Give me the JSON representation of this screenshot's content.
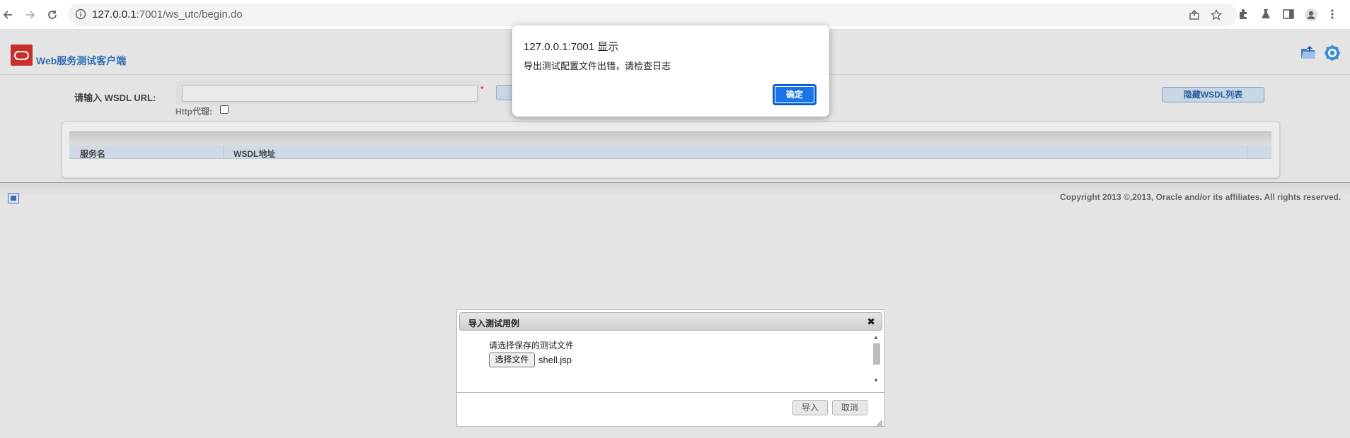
{
  "browser": {
    "url_host": "127.0.0.1",
    "url_rest": ":7001/ws_utc/begin.do"
  },
  "app": {
    "title": "Web服务测试客户端"
  },
  "form": {
    "wsdl_label": "请输入 WSDL URL:",
    "required_mark": "*",
    "proxy_label": "Http代理:",
    "hide_button": "隐藏WSDL列表"
  },
  "table": {
    "columns": [
      "服务名",
      "WSDL地址"
    ]
  },
  "footer": {
    "copyright": "Copyright 2013 ©,2013, Oracle and/or its affiliates. All rights reserved."
  },
  "import_dialog": {
    "title": "导入测试用例",
    "close_glyph": "✖",
    "prompt": "请选择保存的测试文件",
    "choose_file_button": "选择文件",
    "file_name": "shell.jsp",
    "import_button": "导入",
    "cancel_button": "取消"
  },
  "alert": {
    "title": "127.0.0.1:7001 显示",
    "message": "导出测试配置文件出错，请检查日志",
    "ok_button": "确定"
  },
  "colors": {
    "accent": "#1a73e8",
    "title_blue": "#2f6eb5",
    "oracle_red": "#c9302c"
  }
}
